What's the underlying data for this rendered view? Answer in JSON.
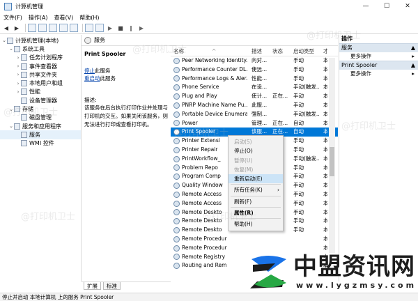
{
  "window": {
    "title": "计算机管理",
    "btn_min": "—",
    "btn_max": "☐",
    "btn_close": "✕"
  },
  "menu": [
    "文件(F)",
    "操作(A)",
    "查看(V)",
    "帮助(H)"
  ],
  "tree": [
    {
      "label": "计算机管理(本地)",
      "level": 0,
      "exp": "⌄"
    },
    {
      "label": "系统工具",
      "level": 1,
      "exp": "⌄"
    },
    {
      "label": "任务计划程序",
      "level": 2,
      "exp": "›"
    },
    {
      "label": "事件查看器",
      "level": 2,
      "exp": "›"
    },
    {
      "label": "共享文件夹",
      "level": 2,
      "exp": "›"
    },
    {
      "label": "本地用户和组",
      "level": 2,
      "exp": "›"
    },
    {
      "label": "性能",
      "level": 2,
      "exp": "›"
    },
    {
      "label": "设备管理器",
      "level": 2,
      "exp": ""
    },
    {
      "label": "存储",
      "level": 1,
      "exp": "⌄"
    },
    {
      "label": "磁盘管理",
      "level": 2,
      "exp": ""
    },
    {
      "label": "服务和应用程序",
      "level": 1,
      "exp": "⌄"
    },
    {
      "label": "服务",
      "level": 2,
      "exp": "",
      "selected": true
    },
    {
      "label": "WMI 控件",
      "level": 2,
      "exp": ""
    }
  ],
  "services_header": "服务",
  "detail": {
    "name": "Print Spooler",
    "stop_prefix": "停止",
    "stop_suffix": "此服务",
    "restart_prefix": "重启动",
    "restart_suffix": "此服务",
    "desc_label": "描述:",
    "desc": "该服务在后台执行打印作业并处理与打印机的交互。如果关闭该服务，则无法进行打印或查看打印机。"
  },
  "columns": {
    "name": "名称",
    "sort": "^",
    "desc": "描述",
    "status": "状态",
    "start": "启动类型",
    "logon": "才"
  },
  "rows": [
    {
      "name": "Peer Networking Identity...",
      "desc": "向对...",
      "status": "",
      "start": "手动",
      "logon": "本"
    },
    {
      "name": "Performance Counter DL...",
      "desc": "使远...",
      "status": "",
      "start": "手动",
      "logon": "本"
    },
    {
      "name": "Performance Logs & Aler...",
      "desc": "性能...",
      "status": "",
      "start": "手动",
      "logon": "本"
    },
    {
      "name": "Phone Service",
      "desc": "在设...",
      "status": "",
      "start": "手动(触发...",
      "logon": "本"
    },
    {
      "name": "Plug and Play",
      "desc": "使计...",
      "status": "正在...",
      "start": "手动",
      "logon": "本"
    },
    {
      "name": "PNRP Machine Name Pu...",
      "desc": "此服...",
      "status": "",
      "start": "手动",
      "logon": "本"
    },
    {
      "name": "Portable Device Enumera...",
      "desc": "强制...",
      "status": "",
      "start": "手动(触发...",
      "logon": "本"
    },
    {
      "name": "Power",
      "desc": "管理...",
      "status": "正在...",
      "start": "自动",
      "logon": "本"
    },
    {
      "name": "Print Spooler",
      "desc": "该服...",
      "status": "正在...",
      "start": "自动",
      "logon": "本",
      "selected": true
    },
    {
      "name": "Printer Extensi",
      "desc": "",
      "status": "",
      "start": "手动",
      "logon": "本"
    },
    {
      "name": "Printer Repair",
      "desc": "",
      "status": "",
      "start": "手动",
      "logon": "本"
    },
    {
      "name": "PrintWorkflow_",
      "desc": "",
      "status": "",
      "start": "手动(触发...",
      "logon": "本"
    },
    {
      "name": "Problem Repo",
      "desc": "",
      "status": "",
      "start": "手动",
      "logon": "本"
    },
    {
      "name": "Program Comp",
      "desc": "",
      "status": "",
      "start": "手动",
      "logon": "本"
    },
    {
      "name": "Quality Window",
      "desc": "",
      "status": "",
      "start": "手动",
      "logon": "本"
    },
    {
      "name": "Remote Access",
      "desc": "",
      "status": "",
      "start": "手动",
      "logon": "本"
    },
    {
      "name": "Remote Access",
      "desc": "",
      "status": "",
      "start": "手动",
      "logon": "本"
    },
    {
      "name": "Remote Deskto",
      "desc": "",
      "status": "",
      "start": "手动",
      "logon": "本"
    },
    {
      "name": "Remote Deskto",
      "desc": "",
      "status": "",
      "start": "手动",
      "logon": "本"
    },
    {
      "name": "Remote Deskto",
      "desc": "",
      "status": "",
      "start": "手动",
      "logon": "本"
    },
    {
      "name": "Remote Procedur",
      "desc": "",
      "status": "",
      "start": "",
      "logon": "本"
    },
    {
      "name": "Remote Procedur",
      "desc": "",
      "status": "",
      "start": "",
      "logon": "本"
    },
    {
      "name": "Remote Registry",
      "desc": "",
      "status": "",
      "start": "",
      "logon": "本"
    },
    {
      "name": "Routing and Rem",
      "desc": "",
      "status": "",
      "start": "",
      "logon": "本"
    }
  ],
  "tabs": [
    "扩展",
    "标准"
  ],
  "context_menu": [
    {
      "label": "启动(S)",
      "disabled": true
    },
    {
      "label": "停止(O)"
    },
    {
      "label": "暂停(U)",
      "disabled": true
    },
    {
      "label": "恢复(M)",
      "disabled": true
    },
    {
      "label": "重新启动(E)",
      "highlighted": true
    },
    {
      "sep": true
    },
    {
      "label": "所有任务(K)",
      "arrow": "›"
    },
    {
      "sep": true
    },
    {
      "label": "刷新(F)"
    },
    {
      "sep": true
    },
    {
      "label": "属性(R)",
      "bold": true
    },
    {
      "sep": true
    },
    {
      "label": "帮助(H)"
    }
  ],
  "actions": {
    "header": "操作",
    "groups": [
      {
        "title": "服务",
        "arrow": "▲",
        "items": [
          {
            "label": "更多操作",
            "arrow": "▸"
          }
        ]
      },
      {
        "title": "Print Spooler",
        "arrow": "▲",
        "items": [
          {
            "label": "更多操作",
            "arrow": "▸"
          }
        ]
      }
    ]
  },
  "status_bar": "停止并启动 本地计算机 上的服务 Print Spooler",
  "watermark": "@打印机卫士",
  "logo": {
    "cn": "中盟资讯网",
    "url": "www.lygzmsy.com"
  },
  "colors": {
    "selection": "#0078d7",
    "menu_highlight": "#cce4f7",
    "logo_blue": "#1a73e8",
    "logo_green": "#27a844"
  }
}
